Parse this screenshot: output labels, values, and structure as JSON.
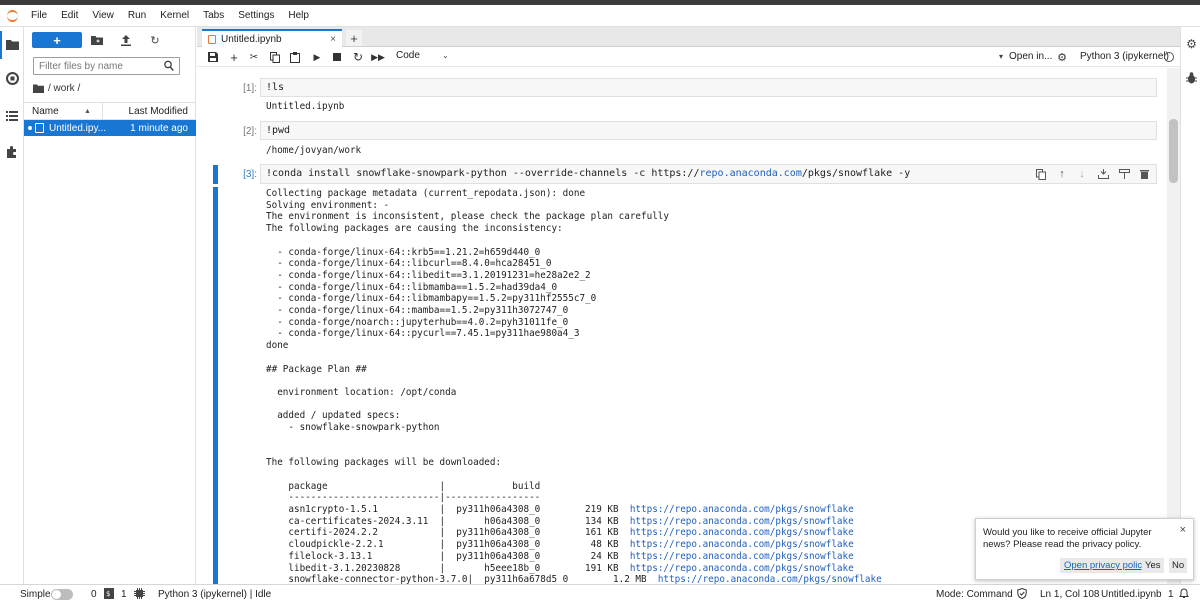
{
  "menubar": {
    "items": [
      "File",
      "Edit",
      "View",
      "Run",
      "Kernel",
      "Tabs",
      "Settings",
      "Help"
    ]
  },
  "filebrowser": {
    "new_label": "+",
    "filter_placeholder": "Filter files by name",
    "breadcrumb": "/ work /",
    "col_name": "Name",
    "col_modified": "Last Modified",
    "files": [
      {
        "name": "Untitled.ipy...",
        "modified": "1 minute ago"
      }
    ]
  },
  "tab": {
    "title": "Untitled.ipynb",
    "close": "×",
    "add": "+"
  },
  "toolbar": {
    "cell_type": "Code",
    "open_in": "Open in...",
    "kernel": "Python 3 (ipykernel)"
  },
  "cells": [
    {
      "prompt": "[1]:",
      "input": "!ls",
      "output": "Untitled.ipynb"
    },
    {
      "prompt": "[2]:",
      "input": "!pwd",
      "output": "/home/jovyan/work"
    },
    {
      "prompt": "[3]:",
      "input_prefix": "!conda install snowflake-snowpark-python --override-channels -c https://",
      "input_url": "repo.anaconda.com",
      "input_suffix": "/pkgs/snowflake -y",
      "output_lines": [
        "Collecting package metadata (current_repodata.json): done",
        "Solving environment: -",
        "The environment is inconsistent, please check the package plan carefully",
        "The following packages are causing the inconsistency:",
        "",
        "  - conda-forge/linux-64::krb5==1.21.2=h659d440_0",
        "  - conda-forge/linux-64::libcurl==8.4.0=hca28451_0",
        "  - conda-forge/linux-64::libedit==3.1.20191231=he28a2e2_2",
        "  - conda-forge/linux-64::libmamba==1.5.2=had39da4_0",
        "  - conda-forge/linux-64::libmambapy==1.5.2=py311hf2555c7_0",
        "  - conda-forge/linux-64::mamba==1.5.2=py311h3072747_0",
        "  - conda-forge/noarch::jupyterhub==4.0.2=pyh31011fe_0",
        "  - conda-forge/linux-64::pycurl==7.45.1=py311hae980a4_3",
        "done",
        "",
        "## Package Plan ##",
        "",
        "  environment location: /opt/conda",
        "",
        "  added / updated specs:",
        "    - snowflake-snowpark-python",
        "",
        "",
        "The following packages will be downloaded:",
        "",
        "    package                    |            build",
        "    ---------------------------|-----------------"
      ],
      "packages": [
        {
          "name": "asn1crypto-1.5.1",
          "build": "py311h06a4308_0",
          "size": "219 KB",
          "url": "https://repo.anaconda.com/pkgs/snowflake"
        },
        {
          "name": "ca-certificates-2024.3.11",
          "build": "h06a4308_0",
          "size": "134 KB",
          "url": "https://repo.anaconda.com/pkgs/snowflake"
        },
        {
          "name": "certifi-2024.2.2",
          "build": "py311h06a4308_0",
          "size": "161 KB",
          "url": "https://repo.anaconda.com/pkgs/snowflake"
        },
        {
          "name": "cloudpickle-2.2.1",
          "build": "py311h06a4308_0",
          "size": "48 KB",
          "url": "https://repo.anaconda.com/pkgs/snowflake"
        },
        {
          "name": "filelock-3.13.1",
          "build": "py311h06a4308_0",
          "size": "24 KB",
          "url": "https://repo.anaconda.com/pkgs/snowflake"
        },
        {
          "name": "libedit-3.1.20230828",
          "build": "h5eee18b_0",
          "size": "191 KB",
          "url": "https://repo.anaconda.com/pkgs/snowflake"
        },
        {
          "name": "snowflake-connector-python-3.7.0",
          "build": "py311h6a678d5_0",
          "size": "1.2 MB",
          "url": "https://repo.anaconda.com/pkgs/snowflake"
        }
      ]
    }
  ],
  "statusbar": {
    "simple": "Simple",
    "terminals": "0",
    "kernels": "1",
    "kernel_status": "Python 3 (ipykernel) | Idle",
    "mode": "Mode: Command",
    "position": "Ln 1, Col 108",
    "file": "Untitled.ipynb",
    "notifications": "1"
  },
  "toast": {
    "message": "Would you like to receive official Jupyter news? Please read the privacy policy.",
    "privacy": "Open privacy policy",
    "yes": "Yes",
    "no": "No",
    "close": "×"
  },
  "colors": {
    "accent": "#1976d2",
    "jupyter_orange": "#f37726",
    "link": "#1f5fbf"
  }
}
